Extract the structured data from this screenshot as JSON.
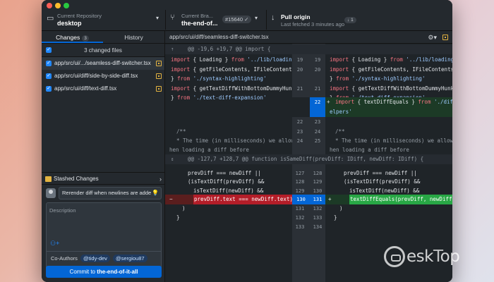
{
  "toolbar": {
    "repo_label": "Current Repository",
    "repo_name": "desktop",
    "branch_label": "Current Bra...",
    "branch_name": "the-end-of...",
    "pr_number": "#15640",
    "pull_title": "Pull origin",
    "pull_subtitle": "Last fetched 3 minutes ago",
    "pull_count": "1"
  },
  "sidebar": {
    "tabs": [
      {
        "label": "Changes",
        "count": "3"
      },
      {
        "label": "History"
      }
    ],
    "changed_header": "3 changed files",
    "files": [
      {
        "path": "app/src/ui/.../seamless-diff-switcher.tsx"
      },
      {
        "path": "app/src/ui/diff/side-by-side-diff.tsx"
      },
      {
        "path": "app/src/ui/diff/text-diff.tsx"
      }
    ],
    "stashed_label": "Stashed Changes",
    "summary_value": "Rerender diff when newlines are adde",
    "description_placeholder": "Description",
    "coauthors_label": "Co-Authors",
    "coauthors": [
      "@tidy-dev",
      "@sergiou87"
    ],
    "commit_prefix": "Commit to ",
    "commit_branch": "the-end-of-it-all"
  },
  "diff": {
    "file_path": "app/src/ui/diff/seamless-diff-switcher.tsx",
    "hunk1": "@@ -19,6 +19,7 @@ import {",
    "hunk2": "@@ -127,7 +128,7 @@ function isSameDiff(prevDiff: IDiff, newDiff: IDiff) {",
    "rows1": [
      {
        "l": [
          "import { Loading } from '../lib/loading'"
        ],
        "ln": "19",
        "rn": "19",
        "r": "import { Loading } from '../lib/loading'"
      },
      {
        "l": "import { getFileContents, IFileContents",
        "ln": "20",
        "rn": "20",
        "r": "import { getFileContents, IFileContents"
      },
      {
        "l": "} from './syntax-highlighting'",
        "ln": "",
        "rn": "",
        "r": "} from './syntax-highlighting'"
      },
      {
        "l": "import { getTextDiffWithBottomDummyHunk",
        "ln": "21",
        "rn": "21",
        "r": "import { getTextDiffWithBottomDummyHunk"
      },
      {
        "l": "} from './text-diff-expansion'",
        "ln": "",
        "rn": "",
        "r": "} from './text-diff-expansion'"
      },
      {
        "l": "",
        "ln": "",
        "rn": "22",
        "r": "import { textDiffEquals } from './diff-h"
      },
      {
        "l": "",
        "ln": "",
        "rn": "",
        "r": "elpers'"
      },
      {
        "l": "",
        "ln": "22",
        "rn": "23",
        "r": ""
      },
      {
        "l": "/**",
        "ln": "23",
        "rn": "24",
        "r": "/**"
      },
      {
        "l": " * The time (in milliseconds) we allow w",
        "ln": "24",
        "rn": "25",
        "r": " * The time (in milliseconds) we allow w"
      },
      {
        "l": "hen loading a diff before",
        "ln": "",
        "rn": "",
        "r": "hen loading a diff before"
      }
    ],
    "rows2": [
      {
        "l": "prevDiff === newDiff ||",
        "ln": "127",
        "rn": "128",
        "r": "prevDiff === newDiff ||"
      },
      {
        "l": "(isTextDiff(prevDiff) &&",
        "ln": "128",
        "rn": "129",
        "r": "(isTextDiff(prevDiff) &&"
      },
      {
        "l": "isTextDiff(newDiff) &&",
        "ln": "129",
        "rn": "130",
        "r": "isTextDiff(newDiff) &&"
      },
      {
        "l": "prevDiff.text === newDiff.text)",
        "ln": "130",
        "rn": "131",
        "r": "textDiffEquals(prevDiff, newDiff))"
      },
      {
        "l": ")",
        "ln": "131",
        "rn": "132",
        "r": ")"
      },
      {
        "l": "}",
        "ln": "132",
        "rn": "133",
        "r": "}"
      },
      {
        "l": "",
        "ln": "133",
        "rn": "134",
        "r": ""
      }
    ]
  },
  "watermark": "4eskTop",
  "colors": {
    "accent": "#0366d6",
    "deletion": "#b31d28",
    "addition": "#28a745",
    "modified": "#e3b341"
  }
}
